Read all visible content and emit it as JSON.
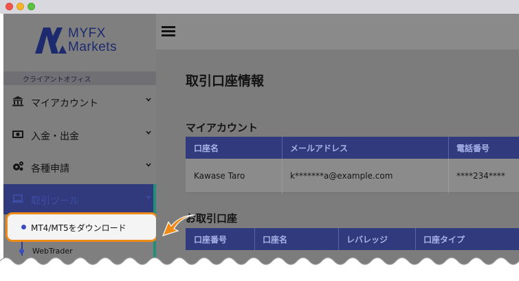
{
  "colors": {
    "accent_navy": "#313a7c",
    "highlight_orange": "#f08a16",
    "teal_edge": "#1f8f78"
  },
  "window": {
    "controls": [
      "close",
      "minimize",
      "maximize"
    ]
  },
  "logo": {
    "line1": "MYFX",
    "line2": "Markets"
  },
  "sidebar": {
    "section_label": "クライアントオフィス",
    "items": [
      {
        "label": "マイアカウント",
        "icon": "bank-icon",
        "expanded": false
      },
      {
        "label": "入金・出金",
        "icon": "money-icon",
        "expanded": false
      },
      {
        "label": "各種申請",
        "icon": "gears-icon",
        "expanded": false
      },
      {
        "label": "取引ツール",
        "icon": "laptop-icon",
        "expanded": true
      }
    ],
    "subitems": [
      {
        "label": "MT4/MT5をダウンロード",
        "highlighted": true
      },
      {
        "label": "WebTrader",
        "highlighted": false
      }
    ]
  },
  "main": {
    "page_title": "取引口座情報",
    "my_account": {
      "title": "マイアカウント",
      "columns": [
        "口座名",
        "メールアドレス",
        "電話番号"
      ],
      "rows": [
        [
          "Kawase Taro",
          "k*******a@example.com",
          "****234****"
        ]
      ]
    },
    "trading_accounts": {
      "title": "お取引口座",
      "columns": [
        "口座番号",
        "口座名",
        "レバレッジ",
        "口座タイプ"
      ]
    }
  }
}
